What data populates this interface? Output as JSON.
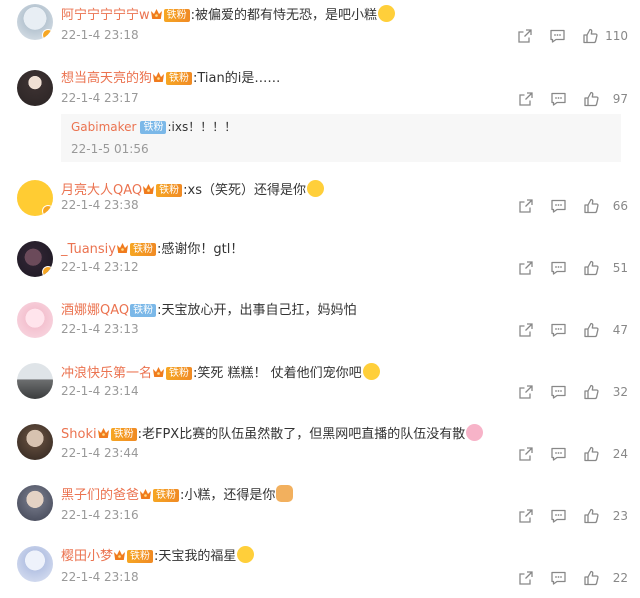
{
  "colors": {
    "username": "#eb7350",
    "text": "#333333",
    "meta": "#999999",
    "badge_gold": "#f6a623",
    "badge_blue": "#7bb8e8"
  },
  "comments": [
    {
      "user": "阿宁宁宁宁宁w",
      "badge": "铁粉",
      "text": ":被偏爱的都有恃无恐，是吧小糕",
      "emoji": "cat-face-emoji",
      "time": "22-1-4 23:18",
      "likes": "110"
    },
    {
      "user": "想当高天亮的狗",
      "badge": "铁粉",
      "text": ":Tian的i是……",
      "emoji": "",
      "time": "22-1-4 23:17",
      "likes": "97",
      "reply": {
        "user": "Gabimaker",
        "badge": "铁粉",
        "text": ":ixs！！！！",
        "time": "22-1-5 01:56"
      }
    },
    {
      "user": "月亮大人QAQ",
      "badge": "铁粉",
      "text": ":xs（笑死）还得是你",
      "emoji": "cat-face-emoji",
      "time": "22-1-4 23:38",
      "likes": "66"
    },
    {
      "user": "_Tuansiy",
      "badge": "铁粉",
      "text": ":感谢你！gtl！",
      "emoji": "",
      "time": "22-1-4 23:12",
      "likes": "51"
    },
    {
      "user": "酒娜娜QAQ",
      "badge": "铁粉",
      "text": ":天宝放心开，出事自己扛，妈妈怕",
      "emoji": "",
      "time": "22-1-4 23:13",
      "likes": "47"
    },
    {
      "user": "冲浪快乐第一名",
      "badge": "铁粉",
      "text": ":笑死 糕糕！ 仗着他们宠你吧",
      "emoji": "smirk-emoji",
      "time": "22-1-4 23:14",
      "likes": "32"
    },
    {
      "user": "Shoki",
      "badge": "铁粉",
      "text": ":老FPX比赛的队伍虽然散了，但黑网吧直播的队伍没有散",
      "emoji": "pig-emoji",
      "time": "22-1-4 23:44",
      "likes": "24"
    },
    {
      "user": "黑子们的爸爸",
      "badge": "铁粉",
      "text": ":小糕，还得是你",
      "emoji": "fist-emoji",
      "time": "22-1-4 23:16",
      "likes": "23"
    },
    {
      "user": "樱田小梦",
      "badge": "铁粉",
      "text": ":天宝我的福星",
      "emoji": "shy-emoji",
      "time": "22-1-4 23:18",
      "likes": "22"
    }
  ]
}
